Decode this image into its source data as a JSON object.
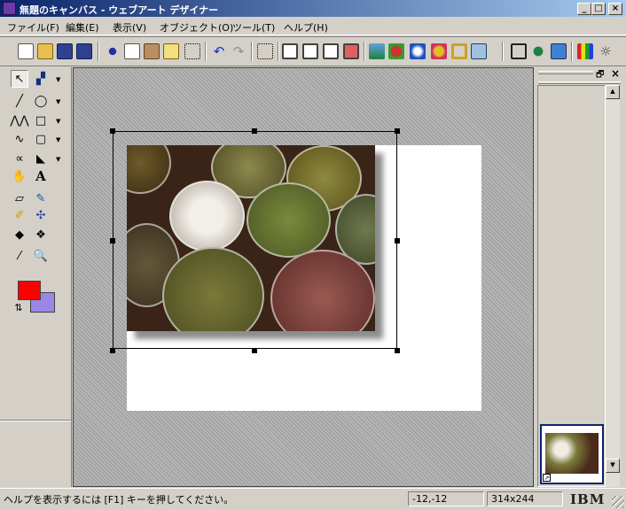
{
  "window": {
    "title": "無題のキャンバス - ウェブアート デザイナー"
  },
  "caption_buttons": {
    "minimize": "_",
    "maximize": "□",
    "close": "×"
  },
  "menu": [
    "ファイル(F)",
    "編集(E)",
    "表示(V)",
    "オブジェクト(O)",
    "ツール(T)",
    "ヘルプ(H)"
  ],
  "toolbar_icons": [
    "new-icon",
    "open-icon",
    "save-icon",
    "save-as-icon",
    "cut-icon",
    "copy-icon",
    "paste-icon",
    "eraser-icon",
    "grid-icon",
    "undo-icon",
    "redo-icon",
    "select-all-icon",
    "canvas-icon",
    "window-icon",
    "layers-icon",
    "gallery-icon",
    "image-icon",
    "3d-object-icon",
    "effects-icon",
    "shape-icon",
    "frame-icon",
    "export-icon",
    "arrange-icon",
    "tree-icon",
    "picture-icon",
    "color-bars-icon",
    "brightness-icon"
  ],
  "toolbox": {
    "text_tool": "A",
    "fill_color": "#ff0000",
    "line_color": "#9b86e6"
  },
  "panel": {
    "close_glyph": "×",
    "restore_glyph": "🗗"
  },
  "status": {
    "help": "ヘルプを表示するには [F1] キーを押してください。",
    "coords": "-12,-12",
    "size": "314x244",
    "brand": "IBM"
  }
}
